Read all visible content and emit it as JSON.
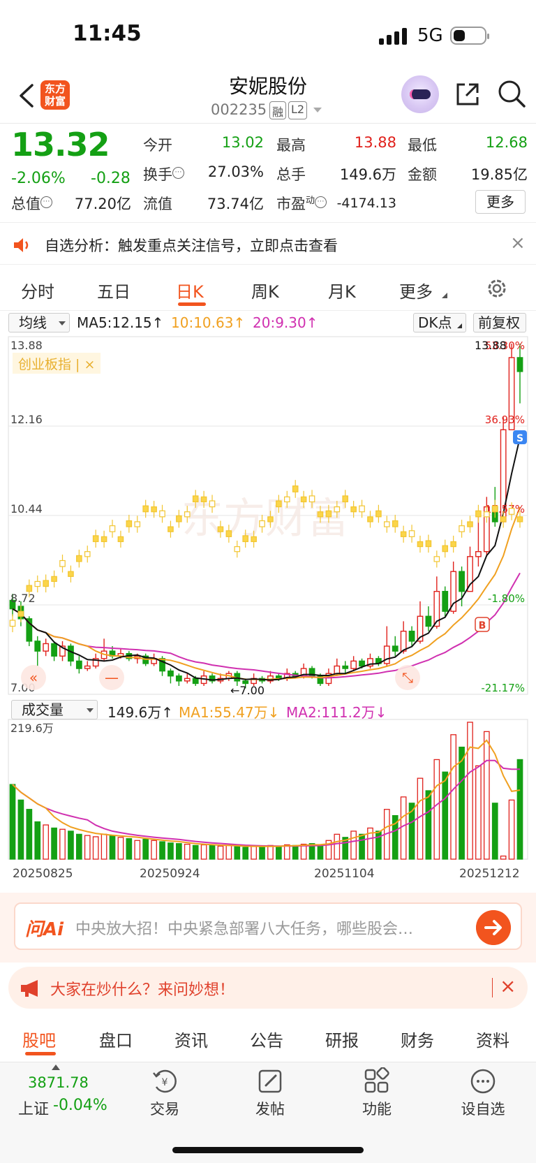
{
  "status": {
    "time": "11:45",
    "network": "5G"
  },
  "header": {
    "brand": [
      "东方",
      "财富"
    ],
    "stock_name": "安妮股份",
    "stock_code": "002235",
    "tags": [
      "融",
      "L2"
    ]
  },
  "quote": {
    "price": "13.32",
    "change_pct": "-2.06%",
    "change": "-0.28",
    "rows": [
      [
        {
          "label": "今开",
          "value": "13.02",
          "color": "#14a014"
        },
        {
          "label": "最高",
          "value": "13.88",
          "color": "#e0211c"
        },
        {
          "label": "最低",
          "value": "12.68",
          "color": "#14a014"
        }
      ],
      [
        {
          "label": "换手",
          "value": "27.03%",
          "color": "#222222"
        },
        {
          "label": "总手",
          "value": "149.6万",
          "color": "#222222"
        },
        {
          "label": "金额",
          "value": "19.85亿",
          "color": "#222222"
        }
      ],
      [
        {
          "label": "总值",
          "value": "77.20亿",
          "color": "#222222"
        },
        {
          "label": "流值",
          "value": "73.74亿",
          "color": "#222222"
        },
        {
          "label": "市盈",
          "sup": "动",
          "value": "-4174.13",
          "color": "#222222"
        }
      ]
    ],
    "more": "更多"
  },
  "alert": {
    "text": "自选分析：触发重点关注信号，立即点击查看"
  },
  "period_tabs": [
    "分时",
    "五日",
    "日K",
    "周K",
    "月K",
    "更多"
  ],
  "active_period": "日K",
  "indicators": {
    "ma_select": "均线",
    "ma5": "MA5:12.15",
    "ma10": "10:10.63",
    "ma20": "20:9.30",
    "dk": "DK点",
    "adjust": "前复权",
    "volume_select": "成交量",
    "vol": "149.6万",
    "vol_ma1": "MA1:55.47万",
    "vol_ma2": "MA2:111.2万"
  },
  "chart_data": {
    "type": "candlestick",
    "y_ticks": [
      "13.88",
      "12.16",
      "10.44",
      "8.72",
      "7.00"
    ],
    "pct_ticks": [
      "53.30%",
      "36.93%",
      "17.57%",
      "-1.80%",
      "-21.17%"
    ],
    "overlay_tag": "创业板指",
    "high_label": "13.88",
    "low_label": "←7.00",
    "x_labels": [
      "20250825",
      "20250924",
      "20251104",
      "20251212"
    ],
    "volume_max_label": "219.6万",
    "ylim": [
      7.0,
      13.88
    ],
    "candles": [
      {
        "o": 8.72,
        "c": 8.55,
        "h": 8.85,
        "l": 8.4
      },
      {
        "o": 8.6,
        "c": 8.35,
        "h": 8.7,
        "l": 8.2
      },
      {
        "o": 8.35,
        "c": 7.9,
        "h": 8.4,
        "l": 7.8
      },
      {
        "o": 7.9,
        "c": 7.7,
        "h": 8.0,
        "l": 7.4
      },
      {
        "o": 7.7,
        "c": 7.85,
        "h": 7.95,
        "l": 7.6
      },
      {
        "o": 7.85,
        "c": 7.6,
        "h": 7.9,
        "l": 7.5
      },
      {
        "o": 7.6,
        "c": 7.8,
        "h": 7.9,
        "l": 7.5
      },
      {
        "o": 7.8,
        "c": 7.5,
        "h": 7.85,
        "l": 7.4
      },
      {
        "o": 7.5,
        "c": 7.35,
        "h": 7.6,
        "l": 7.25
      },
      {
        "o": 7.35,
        "c": 7.4,
        "h": 7.5,
        "l": 7.3
      },
      {
        "o": 7.4,
        "c": 7.55,
        "h": 7.65,
        "l": 7.35
      },
      {
        "o": 7.55,
        "c": 7.7,
        "h": 7.95,
        "l": 7.5
      },
      {
        "o": 7.7,
        "c": 7.6,
        "h": 7.8,
        "l": 7.55
      },
      {
        "o": 7.6,
        "c": 7.65,
        "h": 7.75,
        "l": 7.55
      },
      {
        "o": 7.65,
        "c": 7.55,
        "h": 7.7,
        "l": 7.5
      },
      {
        "o": 7.55,
        "c": 7.6,
        "h": 7.65,
        "l": 7.45
      },
      {
        "o": 7.6,
        "c": 7.45,
        "h": 7.65,
        "l": 7.4
      },
      {
        "o": 7.45,
        "c": 7.55,
        "h": 7.65,
        "l": 7.4
      },
      {
        "o": 7.55,
        "c": 7.3,
        "h": 7.6,
        "l": 7.2
      },
      {
        "o": 7.3,
        "c": 7.2,
        "h": 7.35,
        "l": 7.05
      },
      {
        "o": 7.2,
        "c": 7.1,
        "h": 7.25,
        "l": 7.0
      },
      {
        "o": 7.1,
        "c": 7.15,
        "h": 7.25,
        "l": 7.05
      },
      {
        "o": 7.15,
        "c": 7.05,
        "h": 7.2,
        "l": 7.0
      },
      {
        "o": 7.05,
        "c": 7.2,
        "h": 7.3,
        "l": 7.0
      },
      {
        "o": 7.2,
        "c": 7.1,
        "h": 7.25,
        "l": 7.05
      },
      {
        "o": 7.1,
        "c": 7.15,
        "h": 7.25,
        "l": 7.05
      },
      {
        "o": 7.15,
        "c": 7.25,
        "h": 7.3,
        "l": 7.1
      },
      {
        "o": 7.25,
        "c": 7.1,
        "h": 7.3,
        "l": 7.0
      },
      {
        "o": 7.1,
        "c": 7.05,
        "h": 7.15,
        "l": 6.95
      },
      {
        "o": 7.05,
        "c": 7.15,
        "h": 7.25,
        "l": 7.0
      },
      {
        "o": 7.15,
        "c": 7.1,
        "h": 7.2,
        "l": 7.05
      },
      {
        "o": 7.1,
        "c": 7.2,
        "h": 7.3,
        "l": 7.05
      },
      {
        "o": 7.2,
        "c": 7.15,
        "h": 7.25,
        "l": 7.1
      },
      {
        "o": 7.15,
        "c": 7.25,
        "h": 7.35,
        "l": 7.1
      },
      {
        "o": 7.25,
        "c": 7.2,
        "h": 7.3,
        "l": 7.15
      },
      {
        "o": 7.2,
        "c": 7.35,
        "h": 7.45,
        "l": 7.15
      },
      {
        "o": 7.35,
        "c": 7.2,
        "h": 7.4,
        "l": 7.15
      },
      {
        "o": 7.2,
        "c": 7.05,
        "h": 7.25,
        "l": 7.0
      },
      {
        "o": 7.05,
        "c": 7.25,
        "h": 7.35,
        "l": 7.0
      },
      {
        "o": 7.25,
        "c": 7.4,
        "h": 7.55,
        "l": 7.2
      },
      {
        "o": 7.4,
        "c": 7.35,
        "h": 7.5,
        "l": 7.25
      },
      {
        "o": 7.35,
        "c": 7.5,
        "h": 7.6,
        "l": 7.3
      },
      {
        "o": 7.5,
        "c": 7.4,
        "h": 7.55,
        "l": 7.35
      },
      {
        "o": 7.4,
        "c": 7.55,
        "h": 7.65,
        "l": 7.35
      },
      {
        "o": 7.55,
        "c": 7.45,
        "h": 7.6,
        "l": 7.4
      },
      {
        "o": 7.45,
        "c": 7.8,
        "h": 8.2,
        "l": 7.4
      },
      {
        "o": 7.8,
        "c": 7.7,
        "h": 8.0,
        "l": 7.6
      },
      {
        "o": 7.7,
        "c": 8.1,
        "h": 8.3,
        "l": 7.65
      },
      {
        "o": 8.1,
        "c": 7.9,
        "h": 8.2,
        "l": 7.8
      },
      {
        "o": 7.9,
        "c": 8.4,
        "h": 8.7,
        "l": 7.85
      },
      {
        "o": 8.4,
        "c": 8.2,
        "h": 8.6,
        "l": 8.1
      },
      {
        "o": 8.2,
        "c": 8.9,
        "h": 9.2,
        "l": 8.15
      },
      {
        "o": 8.9,
        "c": 8.5,
        "h": 9.0,
        "l": 8.4
      },
      {
        "o": 8.5,
        "c": 9.3,
        "h": 9.5,
        "l": 8.45
      },
      {
        "o": 9.3,
        "c": 8.9,
        "h": 9.4,
        "l": 8.6
      },
      {
        "o": 8.9,
        "c": 9.6,
        "h": 9.8,
        "l": 8.9
      },
      {
        "o": 9.6,
        "c": 9.7,
        "h": 10.4,
        "l": 9.4
      },
      {
        "o": 9.7,
        "c": 10.6,
        "h": 10.8,
        "l": 9.6
      },
      {
        "o": 10.6,
        "c": 10.3,
        "h": 11.0,
        "l": 10.2
      },
      {
        "o": 10.3,
        "c": 12.15,
        "h": 12.4,
        "l": 10.3
      },
      {
        "o": 12.15,
        "c": 13.6,
        "h": 13.88,
        "l": 12.68
      },
      {
        "o": 13.6,
        "c": 13.32,
        "h": 13.88,
        "l": 12.68
      }
    ],
    "volume": [
      120,
      95,
      80,
      60,
      55,
      50,
      48,
      45,
      40,
      38,
      36,
      40,
      38,
      35,
      33,
      30,
      32,
      30,
      28,
      26,
      25,
      24,
      22,
      23,
      22,
      21,
      22,
      20,
      19,
      21,
      20,
      22,
      21,
      23,
      22,
      24,
      25,
      22,
      30,
      40,
      35,
      45,
      40,
      50,
      45,
      80,
      70,
      100,
      90,
      130,
      110,
      160,
      140,
      200,
      180,
      220,
      150,
      205,
      90,
      5,
      95,
      160
    ]
  },
  "ai_bar": {
    "logo": "问Ai",
    "text": "中央放大招！中央紧急部署八大任务，哪些股会…"
  },
  "hot_bar": {
    "text": "大家在炒什么？来问妙想！"
  },
  "bottom_tabs": [
    "股吧",
    "盘口",
    "资讯",
    "公告",
    "研报",
    "财务",
    "资料"
  ],
  "nav": {
    "index_value": "3871.78",
    "index_label": "上证",
    "index_pct": "-0.04%",
    "items": [
      "交易",
      "发帖",
      "功能",
      "设自选"
    ]
  }
}
